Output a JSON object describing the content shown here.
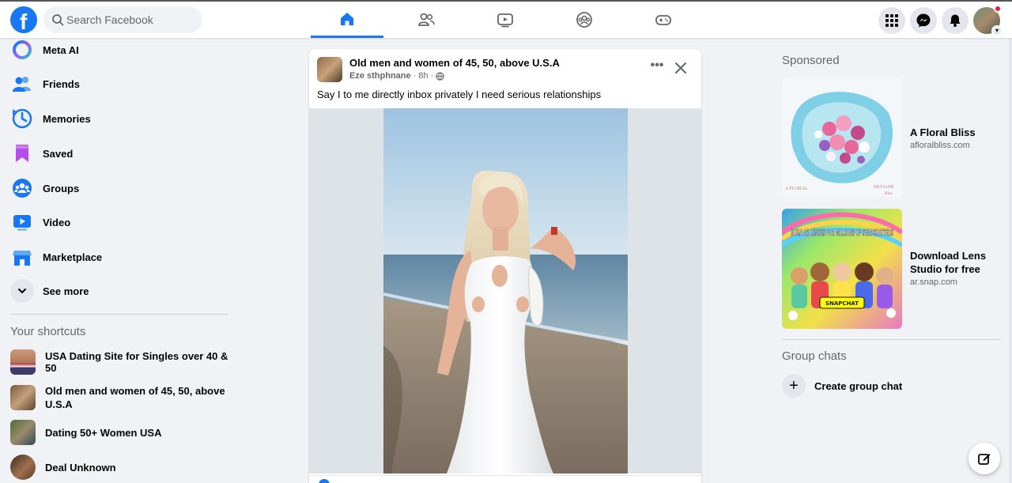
{
  "topbar": {
    "search_placeholder": "Search Facebook",
    "logo_letter": "f",
    "tabs": [
      "home-icon",
      "friends-icon",
      "watch-icon",
      "groups-icon",
      "gaming-icon"
    ],
    "active_tab": "home"
  },
  "sidebar": {
    "items": [
      {
        "label": "Meta AI",
        "icon": "meta-ai-icon"
      },
      {
        "label": "Friends",
        "icon": "friends-icon"
      },
      {
        "label": "Memories",
        "icon": "memories-icon"
      },
      {
        "label": "Saved",
        "icon": "saved-icon"
      },
      {
        "label": "Groups",
        "icon": "groups-icon"
      },
      {
        "label": "Video",
        "icon": "video-icon"
      },
      {
        "label": "Marketplace",
        "icon": "marketplace-icon"
      },
      {
        "label": "See more",
        "icon": "chevron-down-icon"
      }
    ],
    "shortcuts_title": "Your shortcuts",
    "shortcuts": [
      {
        "label": "USA Dating Site for Singles over 40 & 50"
      },
      {
        "label_line1": "Old men and women of 45, 50, above",
        "label_line2": "U.S.A"
      },
      {
        "label": "Dating 50+ Women USA"
      },
      {
        "label": "Deal Unknown"
      }
    ]
  },
  "post": {
    "group_name": "Old men and women of 45, 50, above U.S.A",
    "author": "Eze sthphnane",
    "time": "8h",
    "separator": "·",
    "text": "Say I to me directly inbox privately I need serious relationships"
  },
  "right": {
    "sponsored_title": "Sponsored",
    "ads": [
      {
        "name": "A Floral Bliss",
        "url": "afloralbliss.com",
        "img_text_left": "A FLORAL",
        "img_text_right": "SKYLINE",
        "img_text_right2": "Bliss"
      },
      {
        "name_line1": "Download Lens",
        "name_line2": "Studio for free",
        "url": "ar.snap.com",
        "img_text": "BUILD AR LENSES FOR MILLIONS OF SNAPCHATTERS",
        "img_badge": "SNAPCHAT"
      }
    ],
    "group_chats_title": "Group chats",
    "create_group_chat": "Create group chat",
    "plus": "+"
  },
  "colors": {
    "brand": "#1877f2",
    "background": "#f0f2f5",
    "secondary_text": "#65676b"
  }
}
